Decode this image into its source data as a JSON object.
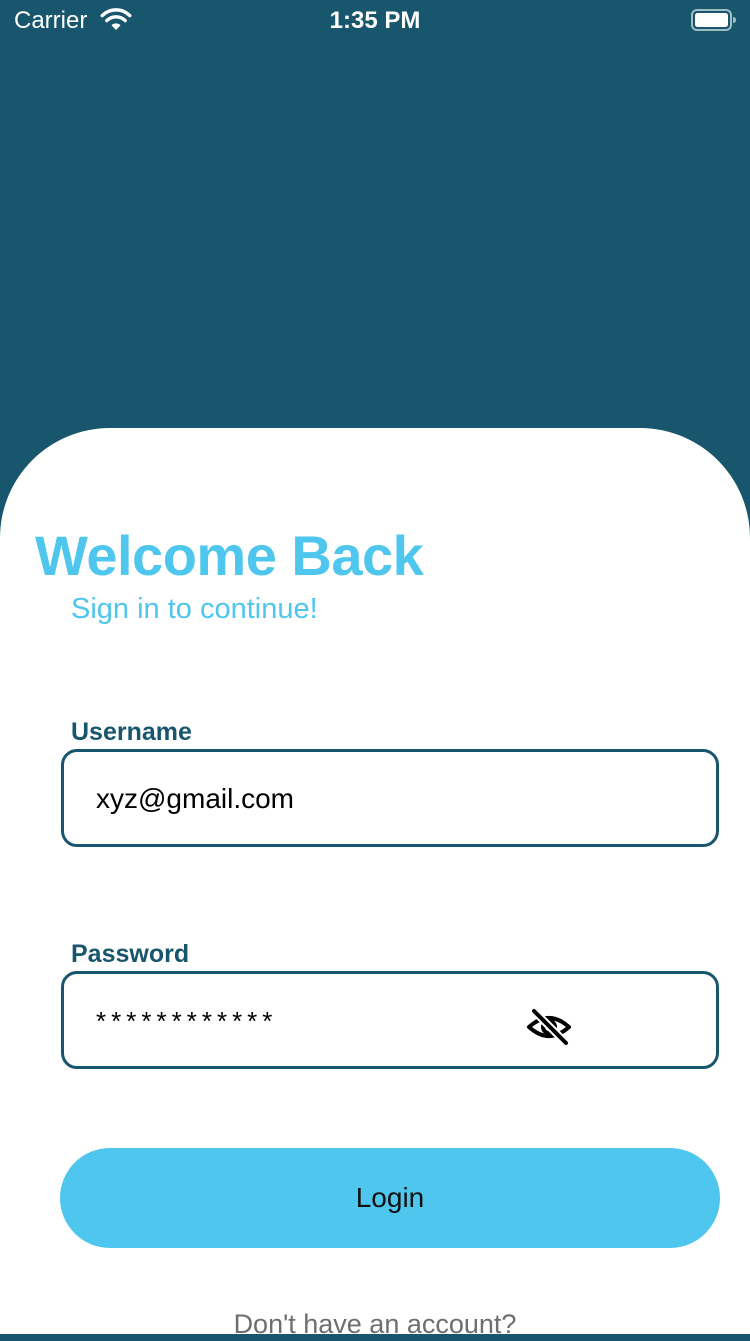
{
  "status_bar": {
    "carrier": "Carrier",
    "time": "1:35 PM",
    "icons": [
      "wifi-icon",
      "battery-icon"
    ]
  },
  "login": {
    "title": "Welcome Back",
    "subtitle": "Sign in to continue!",
    "username": {
      "label": "Username",
      "value": "xyz@gmail.com"
    },
    "password": {
      "label": "Password",
      "value": "************",
      "toggle_icon": "eye-off-icon"
    },
    "login_button_label": "Login",
    "signup_prompt": "Don't have an account?"
  },
  "colors": {
    "header_background": "#17566D",
    "accent": "#4EC6EE",
    "field_border": "#17566D",
    "card_background": "#FFFFFF",
    "muted_text": "#6E6E6E"
  }
}
